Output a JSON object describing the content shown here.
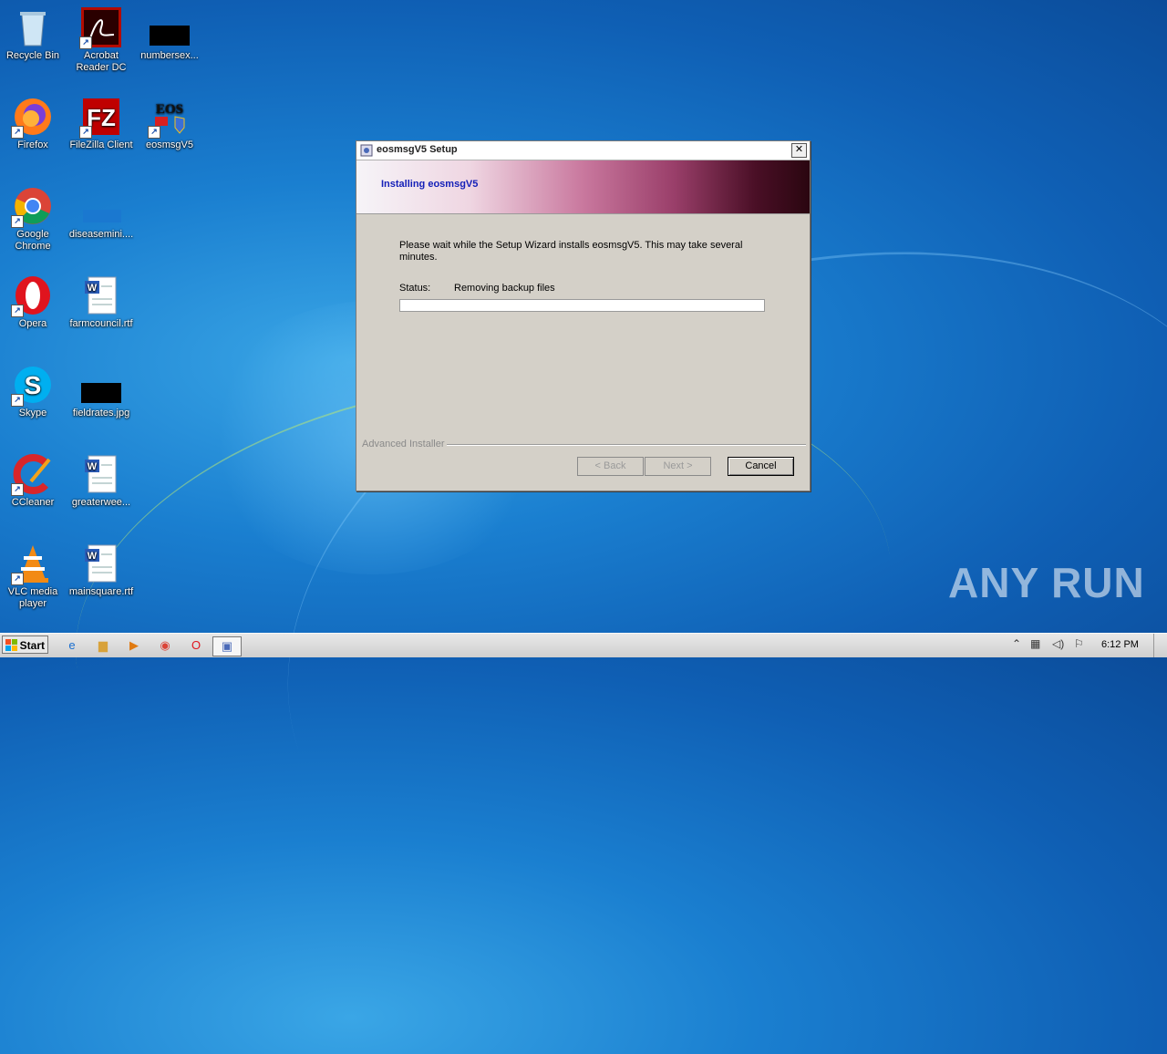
{
  "desktop": {
    "icons": [
      {
        "label": "Recycle Bin"
      },
      {
        "label": "Acrobat Reader DC"
      },
      {
        "label": "numbersex..."
      },
      {
        "label": "Firefox"
      },
      {
        "label": "FileZilla Client"
      },
      {
        "label": "eosmsgV5"
      },
      {
        "label": "Google Chrome"
      },
      {
        "label": "diseasemini...."
      },
      {
        "label": "Opera"
      },
      {
        "label": "farmcouncil.rtf"
      },
      {
        "label": "Skype"
      },
      {
        "label": "fieldrates.jpg"
      },
      {
        "label": "CCleaner"
      },
      {
        "label": "greaterwee..."
      },
      {
        "label": "VLC media player"
      },
      {
        "label": "mainsquare.rtf"
      }
    ],
    "eos_icon_text": "EOS"
  },
  "installer": {
    "window_title": "eosmsgV5 Setup",
    "banner_title": "Installing eosmsgV5",
    "description": "Please wait while the Setup Wizard installs eosmsgV5.  This may take several minutes.",
    "status_label": "Status:",
    "status_value": "Removing backup files",
    "progress_fraction": 0.0,
    "brand": "Advanced Installer",
    "buttons": {
      "back": "< Back",
      "next": "Next >",
      "cancel": "Cancel"
    }
  },
  "taskbar": {
    "start_label": "Start",
    "clock": "6:12 PM"
  },
  "watermark": "ANY RUN",
  "colors": {
    "banner_title": "#1520b8",
    "desktop_bg": "#1a7fd0"
  }
}
